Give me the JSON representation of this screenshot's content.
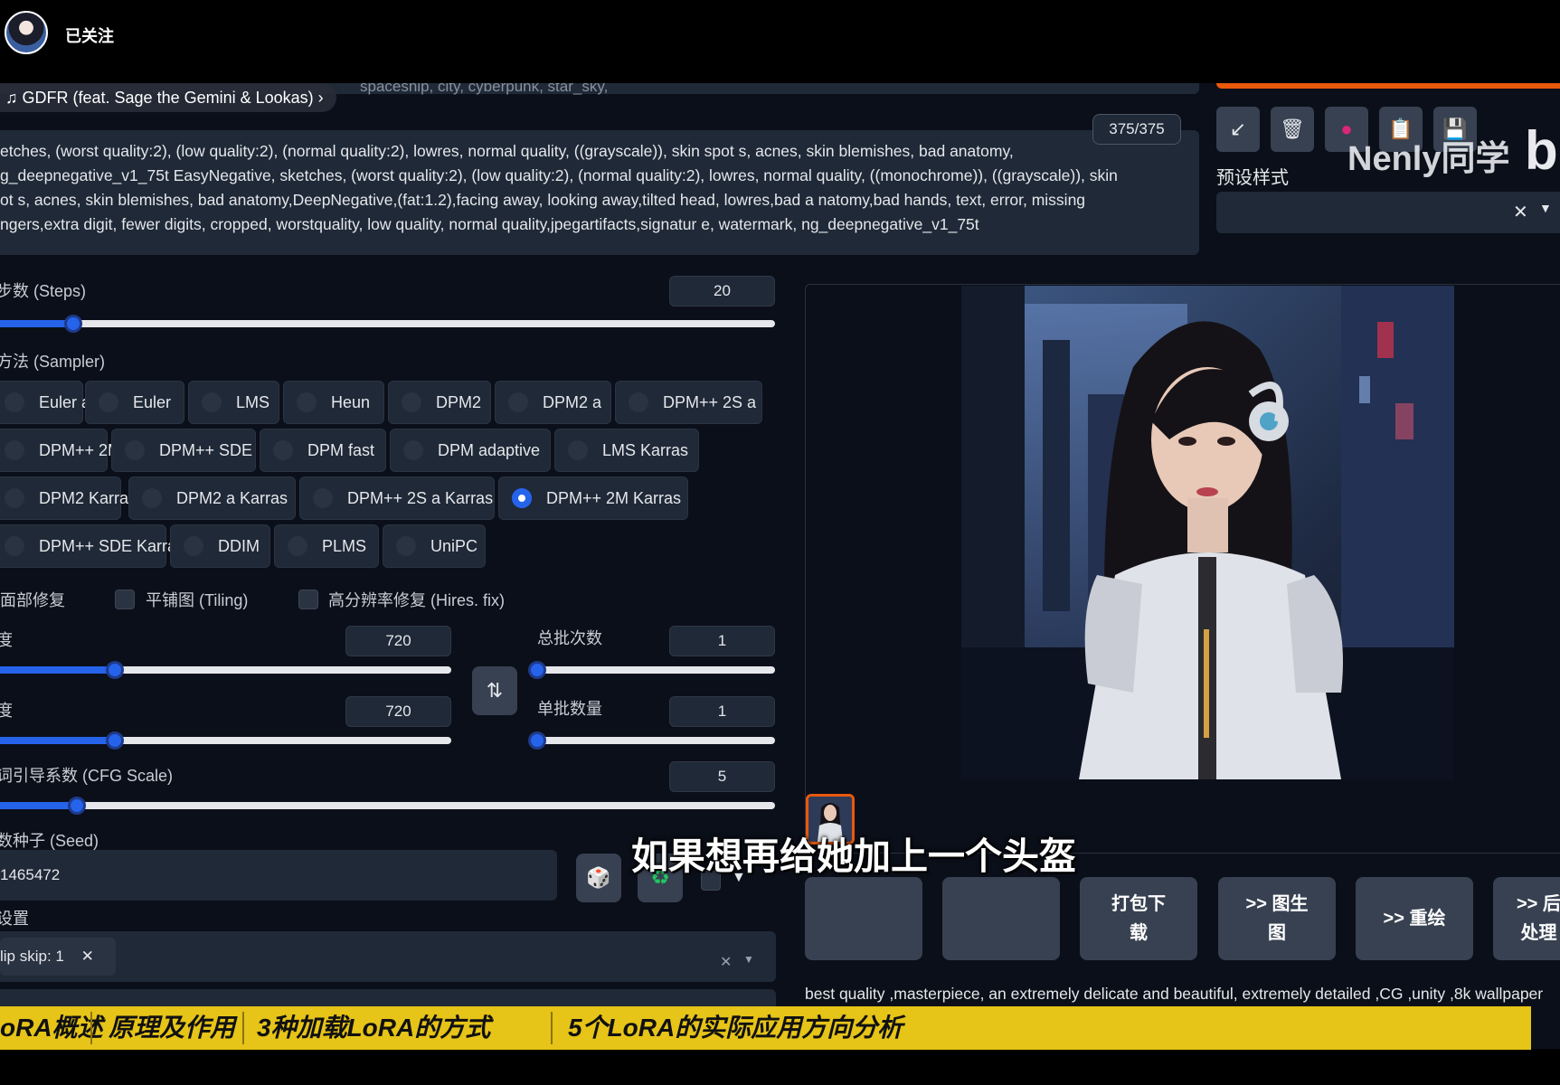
{
  "topbar": {
    "follow_label": "已关注"
  },
  "music": {
    "note_icon": "music-note-icon",
    "title": "GDFR (feat. Sage the Gemini & Lookas)"
  },
  "prompt": {
    "overflow_text": "spaceship, city, cyberpunk, star_sky,",
    "token_counter": "375/375",
    "negative_lines": [
      "etches, (worst quality:2), (low quality:2), (normal quality:2), lowres, normal quality, ((grayscale)), skin spot s, acnes, skin blemishes, bad anatomy,",
      "g_deepnegative_v1_75t EasyNegative, sketches, (worst quality:2), (low quality:2), (normal quality:2), lowres, normal quality, ((monochrome)), ((grayscale)), skin",
      "ot s, acnes, skin blemishes, bad anatomy,DeepNegative,(fat:1.2),facing away, looking away,tilted head, lowres,bad a natomy,bad hands, text, error, missing",
      "ngers,extra digit, fewer digits, cropped, worstquality, low quality, normal quality,jpegartifacts,signatur e, watermark, ng_deepnegative_v1_75t"
    ]
  },
  "tools": {
    "icons": [
      "arrow-icon",
      "trash-icon",
      "palette-icon",
      "clipboard-icon",
      "save-icon"
    ],
    "glyphs": [
      "↙",
      "🗑",
      "●",
      "📋",
      "💾"
    ]
  },
  "watermark": {
    "text": "Nenly同学",
    "logo": "b"
  },
  "preset": {
    "label": "预设样式",
    "clear": "✕",
    "caret": "▼"
  },
  "steps": {
    "label": "步数 (Steps)",
    "value": "20",
    "fraction": 0.105
  },
  "sampler": {
    "label": "方法 (Sampler)",
    "rows": [
      [
        "Euler a",
        "Euler",
        "LMS",
        "Heun",
        "DPM2",
        "DPM2 a",
        "DPM++ 2S a"
      ],
      [
        "DPM++ 2M",
        "DPM++ SDE",
        "DPM fast",
        "DPM adaptive",
        "LMS Karras"
      ],
      [
        "DPM2 Karras",
        "DPM2 a Karras",
        "DPM++ 2S a Karras",
        "DPM++ 2M Karras"
      ],
      [
        "DPM++ SDE Karras",
        "DDIM",
        "PLMS",
        "UniPC"
      ]
    ],
    "selected": "DPM++ 2M Karras"
  },
  "options": {
    "face_restore": "面部修复",
    "tiling": "平铺图 (Tiling)",
    "hires": "高分辨率修复 (Hires. fix)"
  },
  "width": {
    "label": "度",
    "value": "720",
    "fraction": 0.27
  },
  "height": {
    "label": "度",
    "value": "720",
    "fraction": 0.27
  },
  "swap_icon": "⇅",
  "batch_count": {
    "label": "总批次数",
    "value": "1",
    "fraction": 0
  },
  "batch_size": {
    "label": "单批数量",
    "value": "1",
    "fraction": 0
  },
  "cfg": {
    "label": "词引导系数 (CFG Scale)",
    "value": "5",
    "fraction": 0.11
  },
  "seed": {
    "label": "数种子 (Seed)",
    "value": "1465472",
    "dice_icon": "🎲",
    "recycle_icon": "♻",
    "extra_caret": "▼"
  },
  "extra": {
    "label": "设置",
    "clip_chip": "lip skip: 1",
    "chip_close": "✕",
    "row_clear": "✕",
    "row_caret": "▼"
  },
  "actions": [
    {
      "label": "",
      "name": "folder-button"
    },
    {
      "label": "",
      "name": "save-image-button"
    },
    {
      "label": "打包下\n载",
      "name": "zip-download-button"
    },
    {
      "label": ">> 图生\n图",
      "name": "send-img2img-button"
    },
    {
      "label": ">> 重绘",
      "name": "send-inpaint-button"
    },
    {
      "label": ">> 后\n处理",
      "name": "send-extras-button"
    }
  ],
  "gen_info": "best quality ,masterpiece, an extremely delicate and beautiful, extremely detailed ,CG ,unity ,8k wallpaper",
  "subtitle": "如果想再给她加上一个头盔",
  "chapters": [
    {
      "label": "oRA概述"
    },
    {
      "label": "原理及作用"
    },
    {
      "label": "3种加载LoRA的方式"
    },
    {
      "label": "5个LoRA的实际应用方向分析"
    }
  ]
}
